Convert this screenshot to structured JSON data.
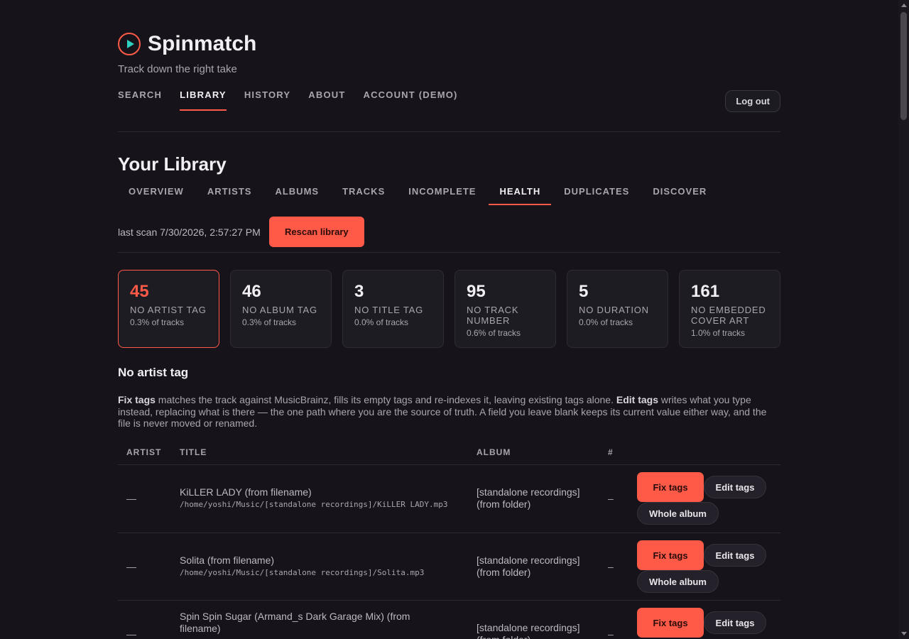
{
  "app": {
    "title": "Spinmatch",
    "tagline": "Track down the right take"
  },
  "mainnav": [
    "SEARCH",
    "LIBRARY",
    "HISTORY",
    "ABOUT",
    "ACCOUNT (DEMO)"
  ],
  "mainnav_active": "LIBRARY",
  "logout_label": "Log out",
  "page_title": "Your Library",
  "subnav": [
    "OVERVIEW",
    "ARTISTS",
    "ALBUMS",
    "TRACKS",
    "INCOMPLETE",
    "HEALTH",
    "DUPLICATES",
    "DISCOVER"
  ],
  "subnav_active": "HEALTH",
  "scan": {
    "last_scan": "last scan 7/30/2026, 2:57:27 PM",
    "rescan_label": "Rescan library"
  },
  "stats": [
    {
      "num": "45",
      "label": "NO ARTIST TAG",
      "pct": "0.3% of tracks",
      "active": true
    },
    {
      "num": "46",
      "label": "NO ALBUM TAG",
      "pct": "0.3% of tracks"
    },
    {
      "num": "3",
      "label": "NO TITLE TAG",
      "pct": "0.0% of tracks"
    },
    {
      "num": "95",
      "label": "NO TRACK NUMBER",
      "pct": "0.6% of tracks"
    },
    {
      "num": "5",
      "label": "NO DURATION",
      "pct": "0.0% of tracks"
    },
    {
      "num": "161",
      "label": "NO EMBEDDED COVER ART",
      "pct": "1.0% of tracks"
    }
  ],
  "section_title": "No artist tag",
  "desc": {
    "fix_label": "Fix tags",
    "fix_text": " matches the track against MusicBrainz, fills its empty tags and re-indexes it, leaving existing tags alone. ",
    "edit_label": "Edit tags",
    "edit_text": " writes what you type instead, replacing what is there — the one path where you are the source of truth. A field you leave blank keeps its current value either way, and the file is never moved or renamed."
  },
  "table": {
    "headers": {
      "artist": "ARTIST",
      "title": "TITLE",
      "album": "ALBUM",
      "num": "#"
    },
    "rows": [
      {
        "artist": "—",
        "title": "KiLLER LADY (from filename)",
        "path": "/home/yoshi/Music/[standalone recordings]/KiLLER LADY.mp3",
        "album": "[standalone recordings] (from folder)",
        "num": "–"
      },
      {
        "artist": "—",
        "title": "Solita (from filename)",
        "path": "/home/yoshi/Music/[standalone recordings]/Solita.mp3",
        "album": "[standalone recordings] (from folder)",
        "num": "–"
      },
      {
        "artist": "—",
        "title": "Spin Spin Sugar (Armand_s Dark Garage Mix) (from filename)",
        "path": "",
        "album": "[standalone recordings] (from folder)",
        "num": "–"
      }
    ],
    "actions": {
      "fix": "Fix tags",
      "edit": "Edit tags",
      "album": "Whole album"
    }
  },
  "colors": {
    "accent": "#ff5a47",
    "logo_play": "#2fd1c2",
    "background": "#16141a"
  }
}
